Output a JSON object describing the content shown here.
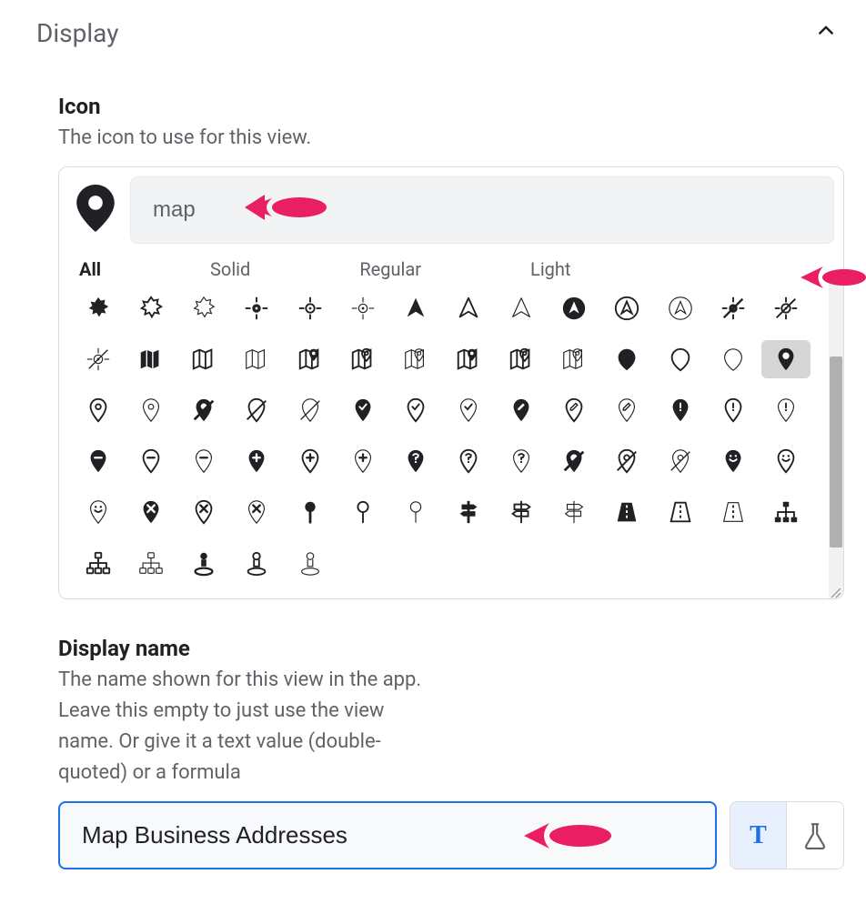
{
  "section": {
    "title": "Display"
  },
  "icon_field": {
    "title": "Icon",
    "description": "The icon to use for this view.",
    "search_value": "map",
    "tabs": [
      "All",
      "Solid",
      "Regular",
      "Light"
    ],
    "active_tab": "All",
    "selected_icon": "map-marker-solid",
    "icons": [
      "leaf-solid",
      "leaf-outline",
      "leaf-light",
      "crosshair-solid",
      "crosshair-regular",
      "crosshair-light",
      "arrow-nav-solid",
      "arrow-nav-regular",
      "arrow-nav-light",
      "arrow-nav-circle-solid",
      "arrow-nav-circle-regular",
      "arrow-nav-circle-light",
      "crosshair-slash-solid",
      "crosshair-slash-regular",
      "crosshair-slash-light",
      "map-fold-solid",
      "map-fold-regular",
      "map-fold-light",
      "map-fold-marker-solid",
      "map-fold-marker-regular",
      "map-fold-marker-light",
      "map-fold-marker2-solid",
      "map-fold-marker2-regular",
      "map-fold-marker2-light",
      "map-pin-drop-solid",
      "map-pin-drop-regular",
      "map-pin-drop-light",
      "map-marker-solid",
      "map-pin-outline",
      "map-pin-light",
      "map-pin-slash-solid",
      "map-pin-slash-regular",
      "map-pin-slash-light",
      "map-pin-check-solid",
      "map-pin-check-regular",
      "map-pin-check-light",
      "map-pin-edit-solid",
      "map-pin-edit-regular",
      "map-pin-edit-light",
      "map-pin-exclaim-solid",
      "map-pin-exclaim-regular",
      "map-pin-exclaim-light",
      "map-pin-minus-solid",
      "map-pin-minus-regular",
      "map-pin-minus-light",
      "map-pin-plus-solid",
      "map-pin-plus-regular",
      "map-pin-plus-light",
      "map-pin-question-solid",
      "map-pin-question-regular",
      "map-pin-question-light",
      "map-marker-slash-solid",
      "map-marker-slash-regular",
      "map-marker-slash-light",
      "map-pin-smile-solid",
      "map-pin-smile-regular",
      "map-pin-smile-light",
      "map-pin-x-solid",
      "map-pin-x-regular",
      "map-pin-x-light",
      "pushpin-solid",
      "pushpin-regular",
      "pushpin-light",
      "signpost-solid",
      "signpost-regular",
      "signpost-light",
      "road-solid",
      "road-regular",
      "road-light",
      "sitemap-solid",
      "sitemap-regular",
      "sitemap-light",
      "street-view-solid",
      "street-view-regular",
      "street-view-light"
    ]
  },
  "display_name_field": {
    "title": "Display name",
    "description": "The name shown for this view in the app. Leave this empty to just use the view name. Or give it a text value (double-quoted) or a formula",
    "value": "Map Business Addresses",
    "mode_text_label": "T"
  }
}
